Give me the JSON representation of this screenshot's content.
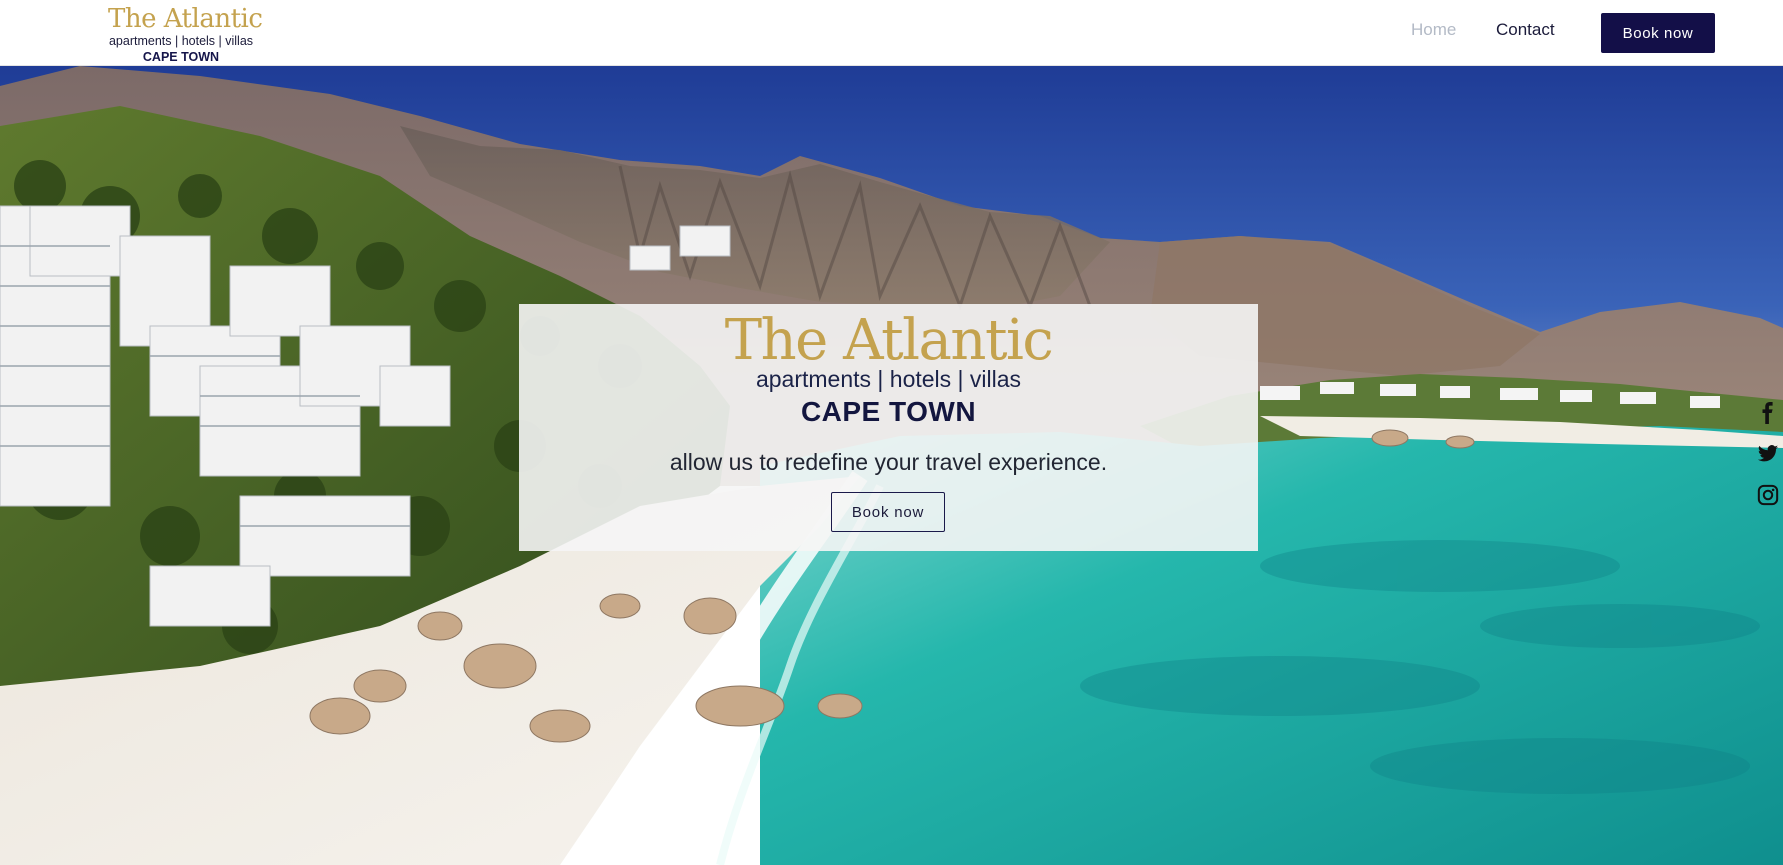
{
  "header": {
    "logo": {
      "title": "The Atlantic",
      "subtitle": "apartments | hotels | villas",
      "city": "CAPE TOWN"
    },
    "nav": [
      {
        "label": "Home",
        "active": true
      },
      {
        "label": "Contact",
        "active": false
      }
    ],
    "book_label": "Book now"
  },
  "hero": {
    "background": "coastline-with-mountains-and-turquoise-sea",
    "card": {
      "title": "The Atlantic",
      "subtitle": "apartments | hotels | villas",
      "city": "CAPE TOWN",
      "tagline": "allow us to redefine your travel experience.",
      "book_label": "Book now"
    }
  },
  "social": [
    {
      "icon": "facebook-icon"
    },
    {
      "icon": "twitter-icon"
    },
    {
      "icon": "instagram-icon"
    }
  ],
  "colors": {
    "brand_gold": "#c4a24e",
    "brand_navy": "#130f48",
    "nav_inactive": "#b3bac6",
    "sea": "#1fb4a8",
    "sky": "#2b4ba0"
  }
}
